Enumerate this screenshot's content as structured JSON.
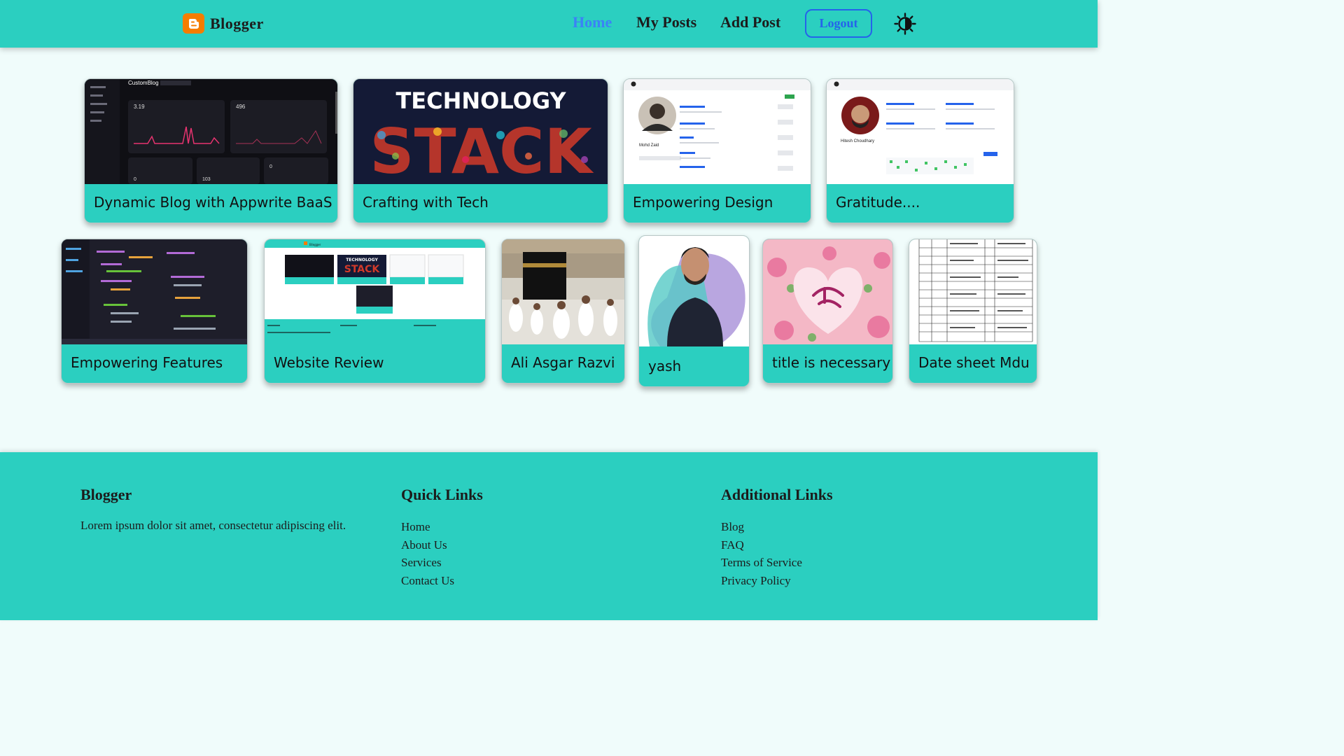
{
  "header": {
    "brand": "Blogger",
    "brand_icon": "blogger-logo-icon",
    "nav": [
      {
        "label": "Home",
        "active": true
      },
      {
        "label": "My Posts",
        "active": false
      },
      {
        "label": "Add Post",
        "active": false
      }
    ],
    "logout_label": "Logout",
    "theme_icon": "sun-moon-icon"
  },
  "posts": [
    {
      "title": "Dynamic Blog with Appwrite BaaS",
      "thumb": "dashboard-screenshot"
    },
    {
      "title": "Crafting with Tech",
      "thumb": "technology-stack-image"
    },
    {
      "title": "Empowering Design",
      "thumb": "github-profile-screenshot"
    },
    {
      "title": "Gratitude....",
      "thumb": "github-profile-screenshot"
    },
    {
      "title": "Empowering Features",
      "thumb": "code-editor-screenshot"
    },
    {
      "title": "Website Review",
      "thumb": "website-screenshot"
    },
    {
      "title": "Ali Asgar Razvi",
      "thumb": "kaaba-photo"
    },
    {
      "title": "yash",
      "thumb": "portrait-photo"
    },
    {
      "title": "title is necessary",
      "thumb": "floral-calligraphy-image"
    },
    {
      "title": "Date sheet Mdu",
      "thumb": "date-sheet-table-image"
    }
  ],
  "thumb_text": {
    "dash_app": "CustomBlog",
    "dash_v1": "3.19",
    "dash_v2": "496",
    "dash_v3": "0",
    "dash_v4": "0",
    "dash_v5": "103",
    "tech_heading": "TECHNOLOGY",
    "tech_stack": "STACK",
    "ws_tech": "TECHNOLOGY",
    "ws_stack": "STACK",
    "ws_brand": "Blogger",
    "profile1_name": "Mohd Zaid",
    "profile2_name": "Hitesh Choudhary"
  },
  "footer": {
    "brand": "Blogger",
    "description": "Lorem ipsum dolor sit amet, consectetur adipiscing elit.",
    "quick_links_title": "Quick Links",
    "quick_links": [
      "Home",
      "About Us",
      "Services",
      "Contact Us"
    ],
    "additional_links_title": "Additional Links",
    "additional_links": [
      "Blog",
      "FAQ",
      "Terms of Service",
      "Privacy Policy"
    ]
  },
  "colors": {
    "teal": "#2bcfc0",
    "background": "#f0fcfb",
    "active_link": "#3b82f6",
    "logout_border": "#2563eb",
    "brand_orange": "#f57d00"
  }
}
